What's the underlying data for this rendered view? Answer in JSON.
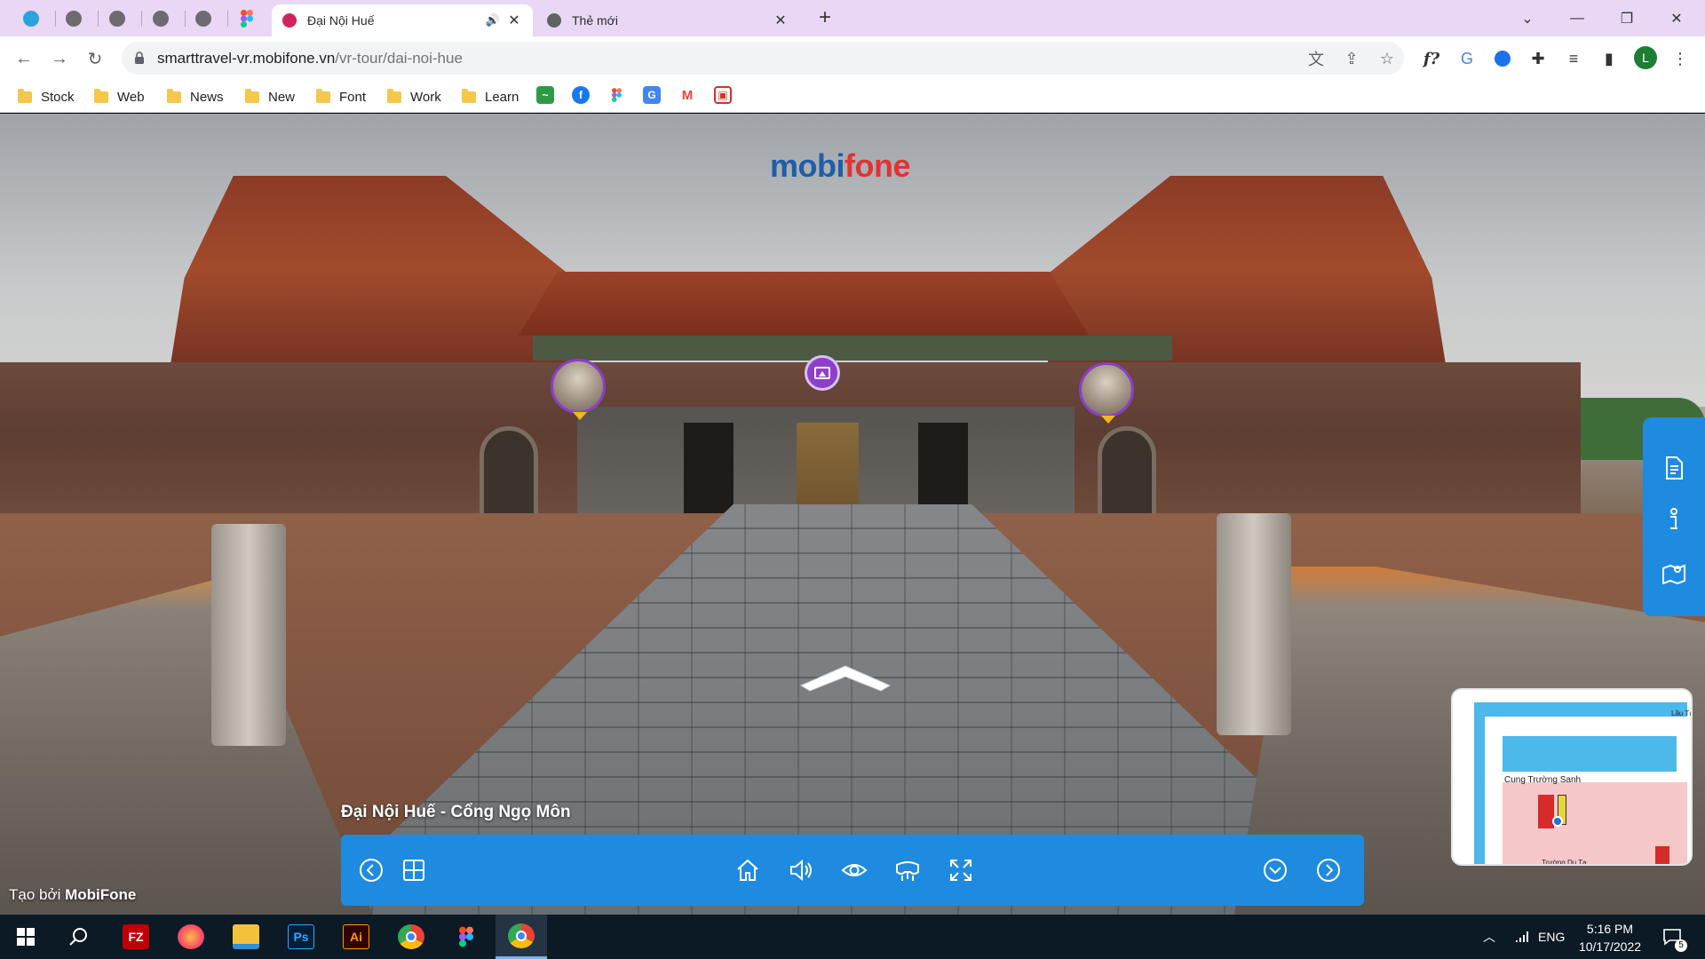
{
  "browser": {
    "tabs": [
      {
        "title": "Đại Nội Huế",
        "active": true
      },
      {
        "title": "Thẻ mới",
        "active": false
      }
    ],
    "address": {
      "host": "smarttravel-vr.mobifone.vn",
      "path": "/vr-tour/dai-noi-hue"
    },
    "bookmarks": [
      "Stock",
      "Web",
      "News",
      "New",
      "Font",
      "Work",
      "Learn"
    ],
    "profile_initial": "L",
    "extension_fx_label": "f?"
  },
  "tour": {
    "logo_part1": "mobi",
    "logo_part2": "fone",
    "caption": "Đại Nội Huế - Cổng Ngọ Môn",
    "credit_prefix": "Tạo bởi ",
    "credit_brand": "MobiFone",
    "minimap": {
      "label_main": "Cung Trường Sanh",
      "label_bottom": "Trường Du Tạ",
      "label_top_right": "Lầu Tứ"
    },
    "accent_color": "#1f8be0",
    "hotspot_color": "#8a3ec8"
  },
  "taskbar": {
    "language": "ENG",
    "time": "5:16 PM",
    "date": "10/17/2022",
    "notification_count": "5",
    "apps": [
      "filezilla",
      "firefox",
      "file-explorer",
      "photoshop",
      "illustrator",
      "chrome",
      "figma",
      "chrome-profile"
    ]
  }
}
